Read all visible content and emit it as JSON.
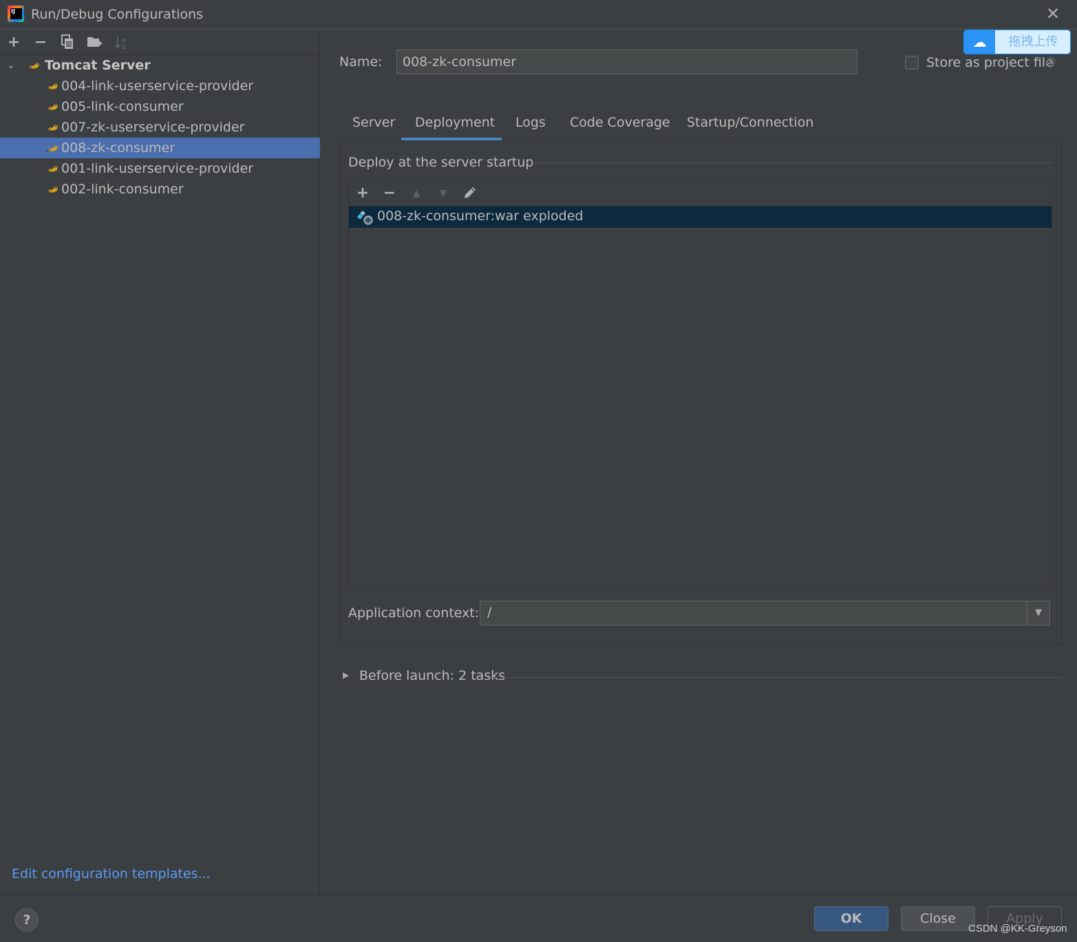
{
  "window": {
    "title": "Run/Debug Configurations",
    "close_icon": "close-x-icon"
  },
  "left_toolbar": {
    "icons": [
      "add-icon",
      "remove-icon",
      "copy-icon",
      "new-folder-icon",
      "sort-alpha-icon"
    ]
  },
  "tree": {
    "group": {
      "label": "Tomcat Server",
      "expanded": true,
      "icon": "tomcat-icon"
    },
    "items": [
      {
        "label": "004-link-userservice-provider",
        "selected": false
      },
      {
        "label": "005-link-consumer",
        "selected": false
      },
      {
        "label": "007-zk-userservice-provider",
        "selected": false
      },
      {
        "label": "008-zk-consumer",
        "selected": true
      },
      {
        "label": "001-link-userservice-provider",
        "selected": false
      },
      {
        "label": "002-link-consumer",
        "selected": false
      }
    ]
  },
  "edit_templates_link": "Edit configuration templates...",
  "config": {
    "name_label": "Name:",
    "name_value": "008-zk-consumer",
    "store_as_project_file": {
      "label": "Store as project file",
      "checked": false
    }
  },
  "overlay": {
    "baidu_upload_label": "拖拽上传"
  },
  "tabs": [
    {
      "label": "Server",
      "active": false
    },
    {
      "label": "Deployment",
      "active": true
    },
    {
      "label": "Logs",
      "active": false
    },
    {
      "label": "Code Coverage",
      "active": false
    },
    {
      "label": "Startup/Connection",
      "active": false
    }
  ],
  "deployment": {
    "section_title": "Deploy at the server startup",
    "toolbar_icons": [
      "add-icon",
      "remove-icon",
      "move-up-icon",
      "move-down-icon",
      "edit-icon"
    ],
    "artifacts": [
      {
        "label": "008-zk-consumer:war exploded",
        "selected": true
      }
    ],
    "app_context_label": "Application context:",
    "app_context_value": "/"
  },
  "before_launch": {
    "label": "Before launch: 2 tasks",
    "expanded": false
  },
  "footer": {
    "help_label": "?",
    "ok_label": "OK",
    "close_label": "Close",
    "apply_label": "Apply",
    "watermark": "CSDN @KK-Greyson"
  },
  "colors": {
    "background": "#3c3f41",
    "selection": "#4b6eaf",
    "tab_underline": "#4a88c7",
    "link": "#589df6",
    "ok_button": "#365880",
    "artifact_selection": "#0d293e"
  }
}
